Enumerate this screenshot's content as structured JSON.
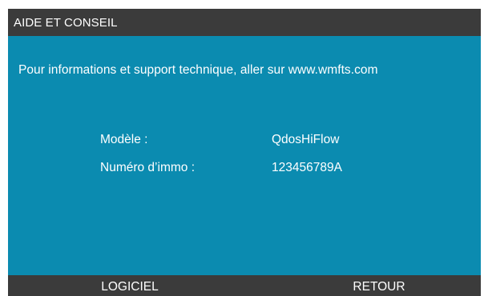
{
  "header": {
    "title": "AIDE ET CONSEIL"
  },
  "main": {
    "info_text": "Pour informations et support technique, aller sur www.wmfts.com",
    "fields": [
      {
        "label": "Modèle :",
        "value": "QdosHiFlow"
      },
      {
        "label": "Numéro d’immo :",
        "value": "123456789A"
      }
    ]
  },
  "softkeys": {
    "left_label": "LOGICIEL",
    "right_label": "RETOUR"
  },
  "colors": {
    "screen_background": "#0b8bb0",
    "bar_background": "#3b3b3b",
    "text": "#ffffff"
  }
}
